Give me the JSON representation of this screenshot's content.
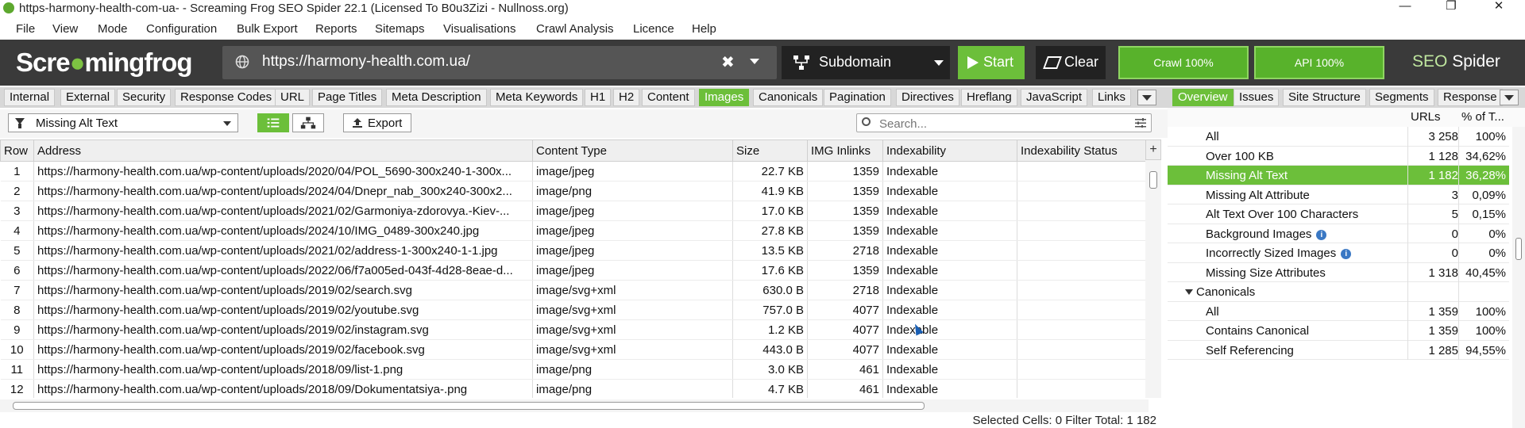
{
  "window": {
    "title": "https-harmony-health-com-ua- - Screaming Frog SEO Spider 22.1 (Licensed To B0u3Zizi - Nullnoss.org)",
    "minimize": "—",
    "maximize": "❐",
    "close": "✕"
  },
  "menu": [
    "File",
    "View",
    "Mode",
    "Configuration",
    "Bulk Export",
    "Reports",
    "Sitemaps",
    "Visualisations",
    "Crawl Analysis",
    "Licence",
    "Help"
  ],
  "toolbar": {
    "logo_left": "Scre",
    "logo_frog": "●",
    "logo_right": "mingfrog",
    "url": "https://harmony-health.com.ua/",
    "clear_url": "✖",
    "mode": "Subdomain",
    "start_label": "Start",
    "clear_label": "Clear",
    "crawl_progress": "Crawl 100%",
    "api_progress": "API 100%",
    "brand_seo": "SEO",
    "brand_spider": "Spider",
    "colors": {
      "accent": "#6cbf3a",
      "toolbar_bg": "#3a3a3a"
    }
  },
  "main_tabs": [
    "Internal",
    "External",
    "Security",
    "Response Codes",
    "URL",
    "Page Titles",
    "Meta Description",
    "Meta Keywords",
    "H1",
    "H2",
    "Content",
    "Images",
    "Canonicals",
    "Pagination",
    "Directives",
    "Hreflang",
    "JavaScript",
    "Links"
  ],
  "main_tabs_active": "Images",
  "filter": {
    "selected": "Missing Alt Text",
    "export_label": "Export",
    "search_placeholder": "Search..."
  },
  "table": {
    "columns": [
      "Row",
      "Address",
      "Content Type",
      "Size",
      "IMG Inlinks",
      "Indexability",
      "Indexability Status"
    ],
    "rows": [
      [
        "1",
        "https://harmony-health.com.ua/wp-content/uploads/2020/04/POL_5690-300x240-1-300x...",
        "image/jpeg",
        "22.7 KB",
        "1359",
        "Indexable",
        ""
      ],
      [
        "2",
        "https://harmony-health.com.ua/wp-content/uploads/2024/04/Dnepr_nab_300x240-300x2...",
        "image/png",
        "41.9 KB",
        "1359",
        "Indexable",
        ""
      ],
      [
        "3",
        "https://harmony-health.com.ua/wp-content/uploads/2021/02/Garmoniya-zdorovya.-Kiev-...",
        "image/jpeg",
        "17.0 KB",
        "1359",
        "Indexable",
        ""
      ],
      [
        "4",
        "https://harmony-health.com.ua/wp-content/uploads/2024/10/IMG_0489-300x240.jpg",
        "image/jpeg",
        "27.8 KB",
        "1359",
        "Indexable",
        ""
      ],
      [
        "5",
        "https://harmony-health.com.ua/wp-content/uploads/2021/02/address-1-300x240-1-1.jpg",
        "image/jpeg",
        "13.5 KB",
        "2718",
        "Indexable",
        ""
      ],
      [
        "6",
        "https://harmony-health.com.ua/wp-content/uploads/2022/06/f7a005ed-043f-4d28-8eae-d...",
        "image/jpeg",
        "17.6 KB",
        "1359",
        "Indexable",
        ""
      ],
      [
        "7",
        "https://harmony-health.com.ua/wp-content/uploads/2019/02/search.svg",
        "image/svg+xml",
        "630.0 B",
        "2718",
        "Indexable",
        ""
      ],
      [
        "8",
        "https://harmony-health.com.ua/wp-content/uploads/2019/02/youtube.svg",
        "image/svg+xml",
        "757.0 B",
        "4077",
        "Indexable",
        ""
      ],
      [
        "9",
        "https://harmony-health.com.ua/wp-content/uploads/2019/02/instagram.svg",
        "image/svg+xml",
        "1.2 KB",
        "4077",
        "Indexable",
        ""
      ],
      [
        "10",
        "https://harmony-health.com.ua/wp-content/uploads/2019/02/facebook.svg",
        "image/svg+xml",
        "443.0 B",
        "4077",
        "Indexable",
        ""
      ],
      [
        "11",
        "https://harmony-health.com.ua/wp-content/uploads/2018/09/list-1.png",
        "image/png",
        "3.0 KB",
        "461",
        "Indexable",
        ""
      ],
      [
        "12",
        "https://harmony-health.com.ua/wp-content/uploads/2018/09/Dokumentatsiya-.png",
        "image/png",
        "4.7 KB",
        "461",
        "Indexable",
        ""
      ]
    ]
  },
  "status": "Selected Cells:  0  Filter Total:  1 182",
  "right_tabs": [
    "Overview",
    "Issues",
    "Site Structure",
    "Segments",
    "Response"
  ],
  "right_tabs_active": "Overview",
  "overview": {
    "headers": {
      "urls": "URLs",
      "pct": "% of T..."
    },
    "rows": [
      {
        "label": "All",
        "urls": "3 258",
        "pct": "100%",
        "indent": 2
      },
      {
        "label": "Over 100 KB",
        "urls": "1 128",
        "pct": "34,62%",
        "indent": 2
      },
      {
        "label": "Missing Alt Text",
        "urls": "1 182",
        "pct": "36,28%",
        "indent": 2,
        "selected": true
      },
      {
        "label": "Missing Alt Attribute",
        "urls": "3",
        "pct": "0,09%",
        "indent": 2
      },
      {
        "label": "Alt Text Over 100 Characters",
        "urls": "5",
        "pct": "0,15%",
        "indent": 2
      },
      {
        "label": "Background Images",
        "urls": "0",
        "pct": "0%",
        "indent": 2,
        "info": true
      },
      {
        "label": "Incorrectly Sized Images",
        "urls": "0",
        "pct": "0%",
        "indent": 2,
        "info": true
      },
      {
        "label": "Missing Size Attributes",
        "urls": "1 318",
        "pct": "40,45%",
        "indent": 2
      },
      {
        "label": "Canonicals",
        "urls": "",
        "pct": "",
        "indent": 1,
        "group": true
      },
      {
        "label": "All",
        "urls": "1 359",
        "pct": "100%",
        "indent": 2
      },
      {
        "label": "Contains Canonical",
        "urls": "1 359",
        "pct": "100%",
        "indent": 2
      },
      {
        "label": "Self Referencing",
        "urls": "1 285",
        "pct": "94,55%",
        "indent": 2
      }
    ]
  }
}
